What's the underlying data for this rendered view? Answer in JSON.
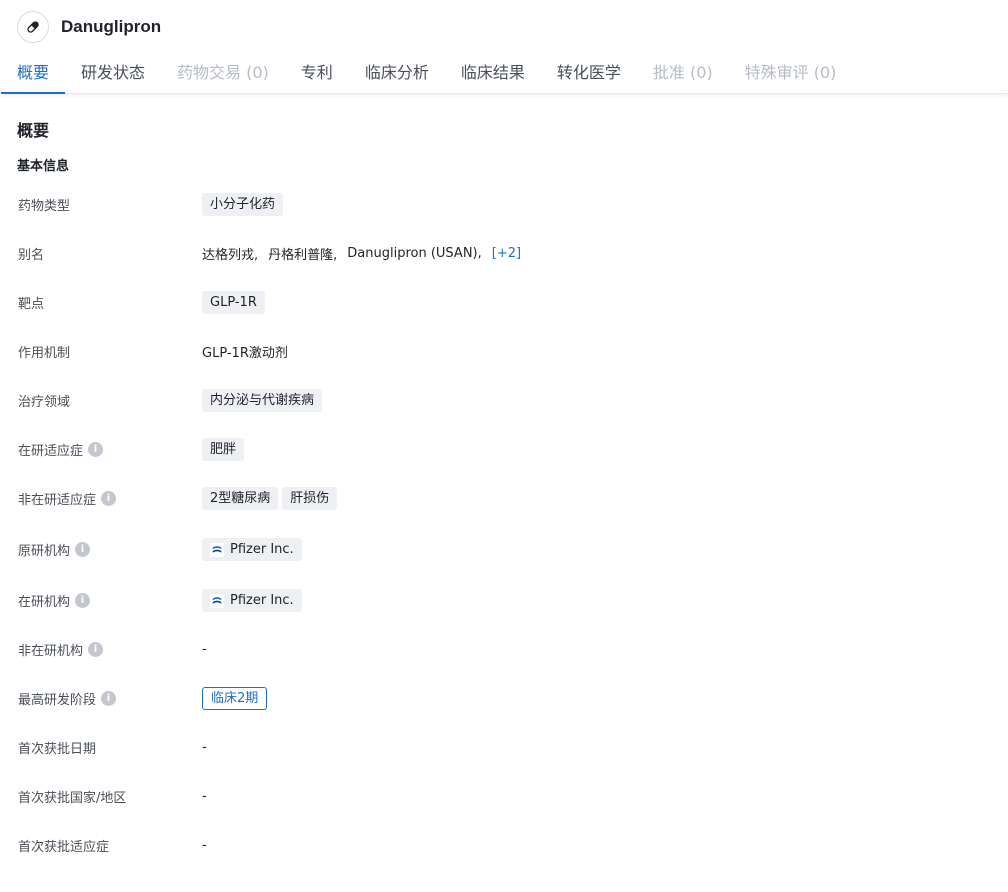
{
  "header": {
    "drug_name": "Danuglipron",
    "icon": "pill-icon"
  },
  "tabs": [
    {
      "label": "概要",
      "state": "active"
    },
    {
      "label": "研发状态",
      "state": "normal"
    },
    {
      "label": "药物交易 (0)",
      "state": "disabled"
    },
    {
      "label": "专利",
      "state": "normal"
    },
    {
      "label": "临床分析",
      "state": "normal"
    },
    {
      "label": "临床结果",
      "state": "normal"
    },
    {
      "label": "转化医学",
      "state": "normal"
    },
    {
      "label": "批准 (0)",
      "state": "disabled"
    },
    {
      "label": "特殊审评 (0)",
      "state": "disabled"
    }
  ],
  "section_title": "概要",
  "basic_info_title": "基本信息",
  "fields": {
    "drug_type": {
      "label": "药物类型",
      "tags": [
        "小分子化药"
      ]
    },
    "alias": {
      "label": "别名",
      "items": [
        "达格列戎,",
        "丹格利普隆,",
        "Danuglipron (USAN),"
      ],
      "more": "[+2]"
    },
    "target": {
      "label": "靶点",
      "tags": [
        "GLP-1R"
      ]
    },
    "mechanism": {
      "label": "作用机制",
      "value": "GLP-1R激动剂"
    },
    "therapeutic_area": {
      "label": "治疗领域",
      "tags": [
        "内分泌与代谢疾病"
      ]
    },
    "active_indication": {
      "label": "在研适应症",
      "tags": [
        "肥胖"
      ]
    },
    "inactive_indication": {
      "label": "非在研适应症",
      "tags": [
        "2型糖尿病",
        "肝损伤"
      ]
    },
    "originator": {
      "label": "原研机构",
      "org": "Pfizer Inc."
    },
    "active_org": {
      "label": "在研机构",
      "org": "Pfizer Inc."
    },
    "inactive_org": {
      "label": "非在研机构",
      "value": "-"
    },
    "highest_phase": {
      "label": "最高研发阶段",
      "tag": "临床2期"
    },
    "first_approval_date": {
      "label": "首次获批日期",
      "value": "-"
    },
    "first_approval_country": {
      "label": "首次获批国家/地区",
      "value": "-"
    },
    "first_approval_indication": {
      "label": "首次获批适应症",
      "value": "-"
    }
  },
  "colors": {
    "accent": "#1e6fc9",
    "tag_bg": "#eef0f3",
    "disabled_text": "#b7bcc4"
  }
}
